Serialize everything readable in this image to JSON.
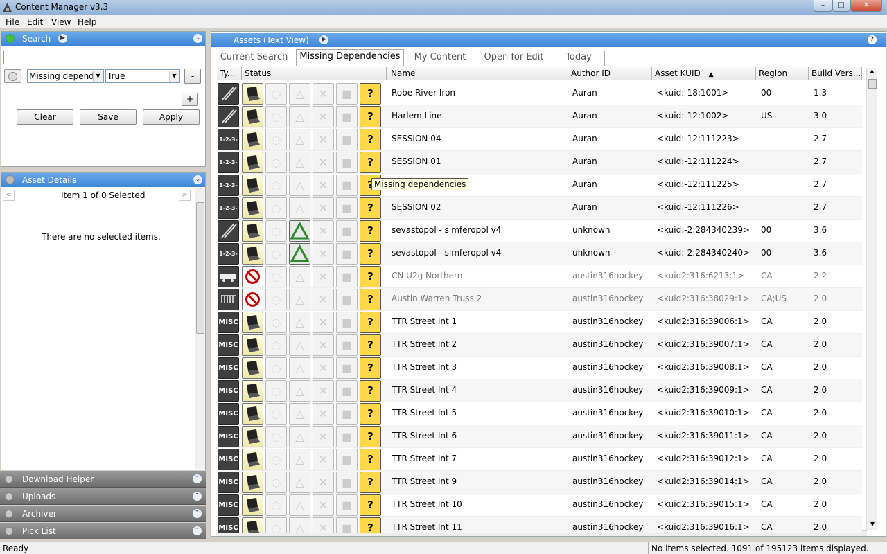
{
  "window": {
    "title": "Content Manager v3.3",
    "controls": [
      "–",
      "□",
      "✕"
    ]
  },
  "menu": [
    "File",
    "Edit",
    "View",
    "Help"
  ],
  "search_panel": {
    "title": "Search",
    "query": "",
    "filter_field": "Missing dependenc",
    "filter_value": "True",
    "remove_label": "-",
    "add_label": "+",
    "buttons": [
      "Clear",
      "Save",
      "Apply"
    ]
  },
  "details_panel": {
    "title": "Asset Details",
    "nav_text": "Item 1 of 0 Selected",
    "empty_text": "There are no selected items."
  },
  "collapsed_panels": [
    "Download Helper",
    "Uploads",
    "Archiver",
    "Pick List"
  ],
  "assets_panel": {
    "title": "Assets (Text View)",
    "help": "?",
    "tabs": [
      "Current Search",
      "Missing Dependencies",
      "My Content",
      "Open for Edit",
      "Today"
    ],
    "active_tab": "Missing Dependencies",
    "columns": [
      "Ty...",
      "Status",
      "Name",
      "Author ID",
      "Asset KUID",
      "Region",
      "Build Vers..."
    ],
    "sort_column": "Asset KUID",
    "tooltip": "Missing dependencies",
    "rows": [
      {
        "type": "route",
        "status": "ok",
        "name": "Robe River Iron",
        "author": "Auran",
        "kuid": "<kuid:-18:1001>",
        "region": "00",
        "build": "1.3",
        "dim": false,
        "tri": false
      },
      {
        "type": "route",
        "status": "ok",
        "name": "Harlem Line",
        "author": "Auran",
        "kuid": "<kuid:-12:1002>",
        "region": "US",
        "build": "3.0",
        "dim": false,
        "tri": false
      },
      {
        "type": "1-2-3-4",
        "status": "ok",
        "name": "SESSION 04",
        "author": "Auran",
        "kuid": "<kuid:-12:111223>",
        "region": "",
        "build": "2.7",
        "dim": false,
        "tri": false
      },
      {
        "type": "1-2-3-4",
        "status": "ok",
        "name": "SESSION 01",
        "author": "Auran",
        "kuid": "<kuid:-12:111224>",
        "region": "",
        "build": "2.7",
        "dim": false,
        "tri": false
      },
      {
        "type": "1-2-3-4",
        "status": "ok",
        "name": "",
        "author": "Auran",
        "kuid": "<kuid:-12:111225>",
        "region": "",
        "build": "2.7",
        "dim": false,
        "tri": false
      },
      {
        "type": "1-2-3-4",
        "status": "ok",
        "name": "SESSION 02",
        "author": "Auran",
        "kuid": "<kuid:-12:111226>",
        "region": "",
        "build": "2.7",
        "dim": false,
        "tri": false
      },
      {
        "type": "route",
        "status": "ok",
        "name": "sevastopol - simferopol v4",
        "author": "unknown",
        "kuid": "<kuid:-2:284340239>",
        "region": "00",
        "build": "3.6",
        "dim": false,
        "tri": true
      },
      {
        "type": "1-2-3-4",
        "status": "ok",
        "name": "sevastopol - simferopol v4",
        "author": "unknown",
        "kuid": "<kuid:-2:284340240>",
        "region": "00",
        "build": "3.6",
        "dim": false,
        "tri": true
      },
      {
        "type": "train",
        "status": "blocked",
        "name": "CN U2g Northern",
        "author": "austin316hockey",
        "kuid": "<kuid2:316:6213:1>",
        "region": "CA",
        "build": "2.2",
        "dim": true,
        "tri": false
      },
      {
        "type": "truss",
        "status": "blocked",
        "name": "Austin Warren Truss 2",
        "author": "austin316hockey",
        "kuid": "<kuid2:316:38029:1>",
        "region": "CA;US",
        "build": "2.0",
        "dim": true,
        "tri": false
      },
      {
        "type": "MISC",
        "status": "ok",
        "name": "TTR Street Int 1",
        "author": "austin316hockey",
        "kuid": "<kuid2:316:39006:1>",
        "region": "CA",
        "build": "2.0",
        "dim": false,
        "tri": false
      },
      {
        "type": "MISC",
        "status": "ok",
        "name": "TTR Street Int 2",
        "author": "austin316hockey",
        "kuid": "<kuid2:316:39007:1>",
        "region": "CA",
        "build": "2.0",
        "dim": false,
        "tri": false
      },
      {
        "type": "MISC",
        "status": "ok",
        "name": "TTR Street Int 3",
        "author": "austin316hockey",
        "kuid": "<kuid2:316:39008:1>",
        "region": "CA",
        "build": "2.0",
        "dim": false,
        "tri": false
      },
      {
        "type": "MISC",
        "status": "ok",
        "name": "TTR Street Int 4",
        "author": "austin316hockey",
        "kuid": "<kuid2:316:39009:1>",
        "region": "CA",
        "build": "2.0",
        "dim": false,
        "tri": false
      },
      {
        "type": "MISC",
        "status": "ok",
        "name": "TTR Street Int 5",
        "author": "austin316hockey",
        "kuid": "<kuid2:316:39010:1>",
        "region": "CA",
        "build": "2.0",
        "dim": false,
        "tri": false
      },
      {
        "type": "MISC",
        "status": "ok",
        "name": "TTR Street Int 6",
        "author": "austin316hockey",
        "kuid": "<kuid2:316:39011:1>",
        "region": "CA",
        "build": "2.0",
        "dim": false,
        "tri": false
      },
      {
        "type": "MISC",
        "status": "ok",
        "name": "TTR Street Int 7",
        "author": "austin316hockey",
        "kuid": "<kuid2:316:39012:1>",
        "region": "CA",
        "build": "2.0",
        "dim": false,
        "tri": false
      },
      {
        "type": "MISC",
        "status": "ok",
        "name": "TTR Street Int 9",
        "author": "austin316hockey",
        "kuid": "<kuid2:316:39014:1>",
        "region": "CA",
        "build": "2.0",
        "dim": false,
        "tri": false
      },
      {
        "type": "MISC",
        "status": "ok",
        "name": "TTR Street Int 10",
        "author": "austin316hockey",
        "kuid": "<kuid2:316:39015:1>",
        "region": "CA",
        "build": "2.0",
        "dim": false,
        "tri": false
      },
      {
        "type": "MISC",
        "status": "ok",
        "name": "TTR Street Int 11",
        "author": "austin316hockey",
        "kuid": "<kuid2:316:39016:1>",
        "region": "CA",
        "build": "2.0",
        "dim": false,
        "tri": false
      }
    ]
  },
  "status_bar": {
    "left": "Ready",
    "right": "No items selected. 1091 of 195123 items displayed."
  },
  "colors": {
    "panel_header": "#4a90dd",
    "warning_icon": "#ffd84a",
    "error_icon": "#cc0000",
    "warning_tri": "#2a8a2a"
  }
}
